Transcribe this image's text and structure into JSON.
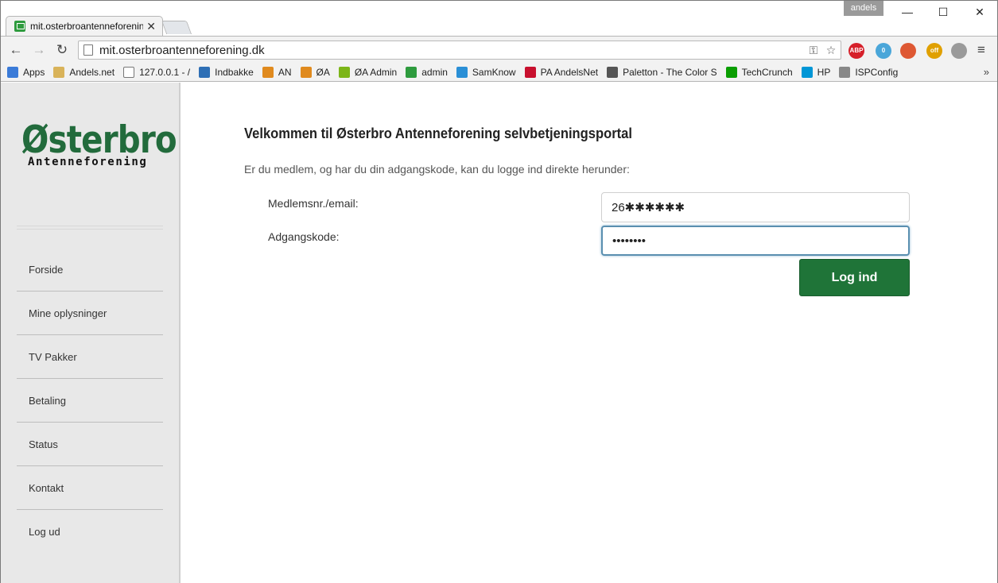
{
  "browser": {
    "tab_title": "mit.osterbroantenneforening.dk",
    "profile_name": "andels",
    "url": "mit.osterbroantenneforening.dk",
    "extensions": [
      {
        "name": "adblock-plus",
        "label": "ABP",
        "color": "#d6202a"
      },
      {
        "name": "ghostery",
        "label": "0",
        "color": "#4aa6d9"
      },
      {
        "name": "duckduckgo",
        "label": "",
        "color": "#de5833"
      },
      {
        "name": "off-toggle",
        "label": "off",
        "color": "#e0a000"
      },
      {
        "name": "settings-gear",
        "label": "",
        "color": "#9a9a9a"
      }
    ],
    "bookmarks": [
      {
        "label": "Apps",
        "icon": "apps-grid-icon",
        "color": "#3b7bd8"
      },
      {
        "label": "Andels.net",
        "icon": "folder-icon",
        "color": "#d9b35a"
      },
      {
        "label": "127.0.0.1 - /",
        "icon": "page-icon",
        "color": "#ffffff"
      },
      {
        "label": "Indbakke",
        "icon": "inbox-icon",
        "color": "#2e6fb5"
      },
      {
        "label": "AN",
        "icon": "pma-icon",
        "color": "#e08a1e"
      },
      {
        "label": "ØA",
        "icon": "pma-icon",
        "color": "#e08a1e"
      },
      {
        "label": "ØA Admin",
        "icon": "admin-icon",
        "color": "#7cb518"
      },
      {
        "label": "admin",
        "icon": "site-icon",
        "color": "#2e9b3e"
      },
      {
        "label": "SamKnow",
        "icon": "samknows-icon",
        "color": "#2a8fd6"
      },
      {
        "label": "PA AndelsNet",
        "icon": "paloalto-icon",
        "color": "#c8102e"
      },
      {
        "label": "Paletton - The Color S",
        "icon": "paletton-icon",
        "color": "#555555"
      },
      {
        "label": "TechCrunch",
        "icon": "techcrunch-icon",
        "color": "#0a9e01"
      },
      {
        "label": "HP",
        "icon": "hp-icon",
        "color": "#0096d6"
      },
      {
        "label": "ISPConfig",
        "icon": "tools-icon",
        "color": "#888888"
      }
    ]
  },
  "site": {
    "logo_main": "Østerbro",
    "logo_sub": "Antenneforening",
    "nav": [
      {
        "label": "Forside"
      },
      {
        "label": "Mine oplysninger"
      },
      {
        "label": "TV Pakker"
      },
      {
        "label": "Betaling"
      },
      {
        "label": "Status"
      },
      {
        "label": "Kontakt"
      },
      {
        "label": "Log ud"
      }
    ]
  },
  "login": {
    "heading": "Velkommen til Østerbro Antenneforening selvbetjeningsportal",
    "intro": "Er du medlem, og har du din adgangskode, kan du logge ind direkte herunder:",
    "member_label": "Medlemsnr./email:",
    "member_value": "26✱✱✱✱✱✱",
    "password_label": "Adgangskode:",
    "password_value": "••••••••",
    "submit_label": "Log ind"
  },
  "colors": {
    "brand_green": "#226b3c",
    "button_green": "#1f7438",
    "sidebar_bg": "#e8e8e8"
  }
}
